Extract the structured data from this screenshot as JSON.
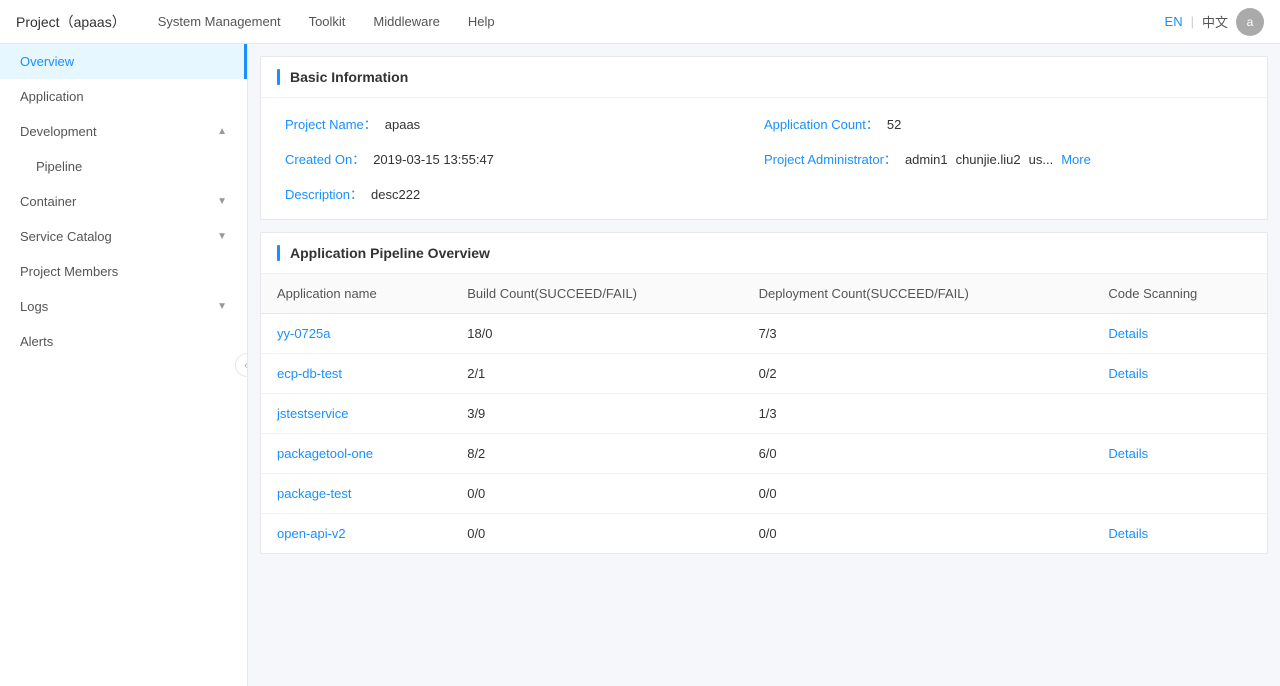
{
  "topnav": {
    "brand": "Project（apaas）",
    "links": [
      "System Management",
      "Toolkit",
      "Middleware",
      "Help"
    ],
    "lang_en": "EN",
    "lang_sep": "|",
    "lang_zh": "中文",
    "avatar_initial": "a"
  },
  "sidebar": {
    "items": [
      {
        "id": "overview",
        "label": "Overview",
        "active": true,
        "sub": false,
        "collapsible": false
      },
      {
        "id": "application",
        "label": "Application",
        "active": false,
        "sub": false,
        "collapsible": false
      },
      {
        "id": "development",
        "label": "Development",
        "active": false,
        "sub": false,
        "collapsible": true,
        "expanded": true
      },
      {
        "id": "pipeline",
        "label": "Pipeline",
        "active": false,
        "sub": true,
        "collapsible": false
      },
      {
        "id": "container",
        "label": "Container",
        "active": false,
        "sub": false,
        "collapsible": true,
        "expanded": false
      },
      {
        "id": "service-catalog",
        "label": "Service Catalog",
        "active": false,
        "sub": false,
        "collapsible": true,
        "expanded": false
      },
      {
        "id": "project-members",
        "label": "Project Members",
        "active": false,
        "sub": false,
        "collapsible": false
      },
      {
        "id": "logs",
        "label": "Logs",
        "active": false,
        "sub": false,
        "collapsible": true,
        "expanded": false
      },
      {
        "id": "alerts",
        "label": "Alerts",
        "active": false,
        "sub": false,
        "collapsible": false
      }
    ],
    "collapse_btn_char": "«"
  },
  "basic_info": {
    "section_title": "Basic Information",
    "project_name_label": "Project Name：",
    "project_name_value": "apaas",
    "created_on_label": "Created On：",
    "created_on_value": "2019-03-15 13:55:47",
    "application_count_label": "Application Count：",
    "application_count_value": "52",
    "project_admin_label": "Project Administrator：",
    "project_admins": [
      "admin1",
      "chunjie.liu2",
      "us..."
    ],
    "more_label": "More",
    "description_label": "Description：",
    "description_value": "desc222"
  },
  "pipeline_overview": {
    "section_title": "Application Pipeline Overview",
    "columns": [
      "Application name",
      "Build Count(SUCCEED/FAIL)",
      "Deployment Count(SUCCEED/FAIL)",
      "Code Scanning"
    ],
    "rows": [
      {
        "app": "yy-0725a",
        "build": "18/0",
        "deploy": "7/3",
        "scanning": "Details",
        "has_details": true
      },
      {
        "app": "ecp-db-test",
        "build": "2/1",
        "deploy": "0/2",
        "scanning": "Details",
        "has_details": true
      },
      {
        "app": "jstestservice",
        "build": "3/9",
        "deploy": "1/3",
        "scanning": "",
        "has_details": false
      },
      {
        "app": "packagetool-one",
        "build": "8/2",
        "deploy": "6/0",
        "scanning": "Details",
        "has_details": true
      },
      {
        "app": "package-test",
        "build": "0/0",
        "deploy": "0/0",
        "scanning": "",
        "has_details": false
      },
      {
        "app": "open-api-v2",
        "build": "0/0",
        "deploy": "0/0",
        "scanning": "Details",
        "has_details": true
      }
    ]
  }
}
